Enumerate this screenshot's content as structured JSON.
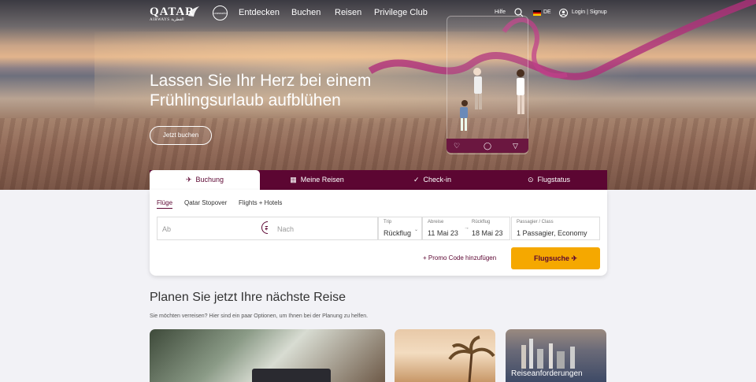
{
  "brand": {
    "logo_text": "QATAR",
    "logo_sub": "AIRWAYS القطرية",
    "badge_text": "oneworld"
  },
  "nav": {
    "items": [
      "Entdecken",
      "Buchen",
      "Reisen",
      "Privilege Club"
    ]
  },
  "utility": {
    "help": "Hilfe",
    "language": "DE",
    "login": "Login | Signup"
  },
  "hero": {
    "title": "Lassen Sie Ihr Herz bei einem Frühlingsurlaub aufblühen",
    "cta": "Jetzt buchen"
  },
  "booking_tabs": [
    "Buchung",
    "Meine Reisen",
    "Check-in",
    "Flugstatus"
  ],
  "sub_tabs": [
    "Flüge",
    "Qatar Stopover",
    "Flights + Hotels"
  ],
  "form": {
    "from_placeholder": "Ab",
    "to_placeholder": "Nach",
    "trip_label": "Trip",
    "trip_value": "Rückflug",
    "depart_label": "Abreise",
    "depart_value": "11 Mai 23",
    "return_label": "Rückflug",
    "return_value": "18 Mai 23",
    "pax_label": "Passagier / Class",
    "pax_value": "1 Passagier, Economy",
    "promo": "+ Promo Code hinzufügen",
    "search": "Flugsuche"
  },
  "plan": {
    "title": "Planen Sie jetzt Ihre nächste Reise",
    "subtitle": "Sie möchten verreisen? Hier sind ein paar Optionen, um Ihnen bei der Planung zu helfen.",
    "cards": [
      "",
      "",
      "Reiseanforderungen"
    ]
  },
  "colors": {
    "brand": "#5c0632",
    "accent": "#f5a800"
  }
}
